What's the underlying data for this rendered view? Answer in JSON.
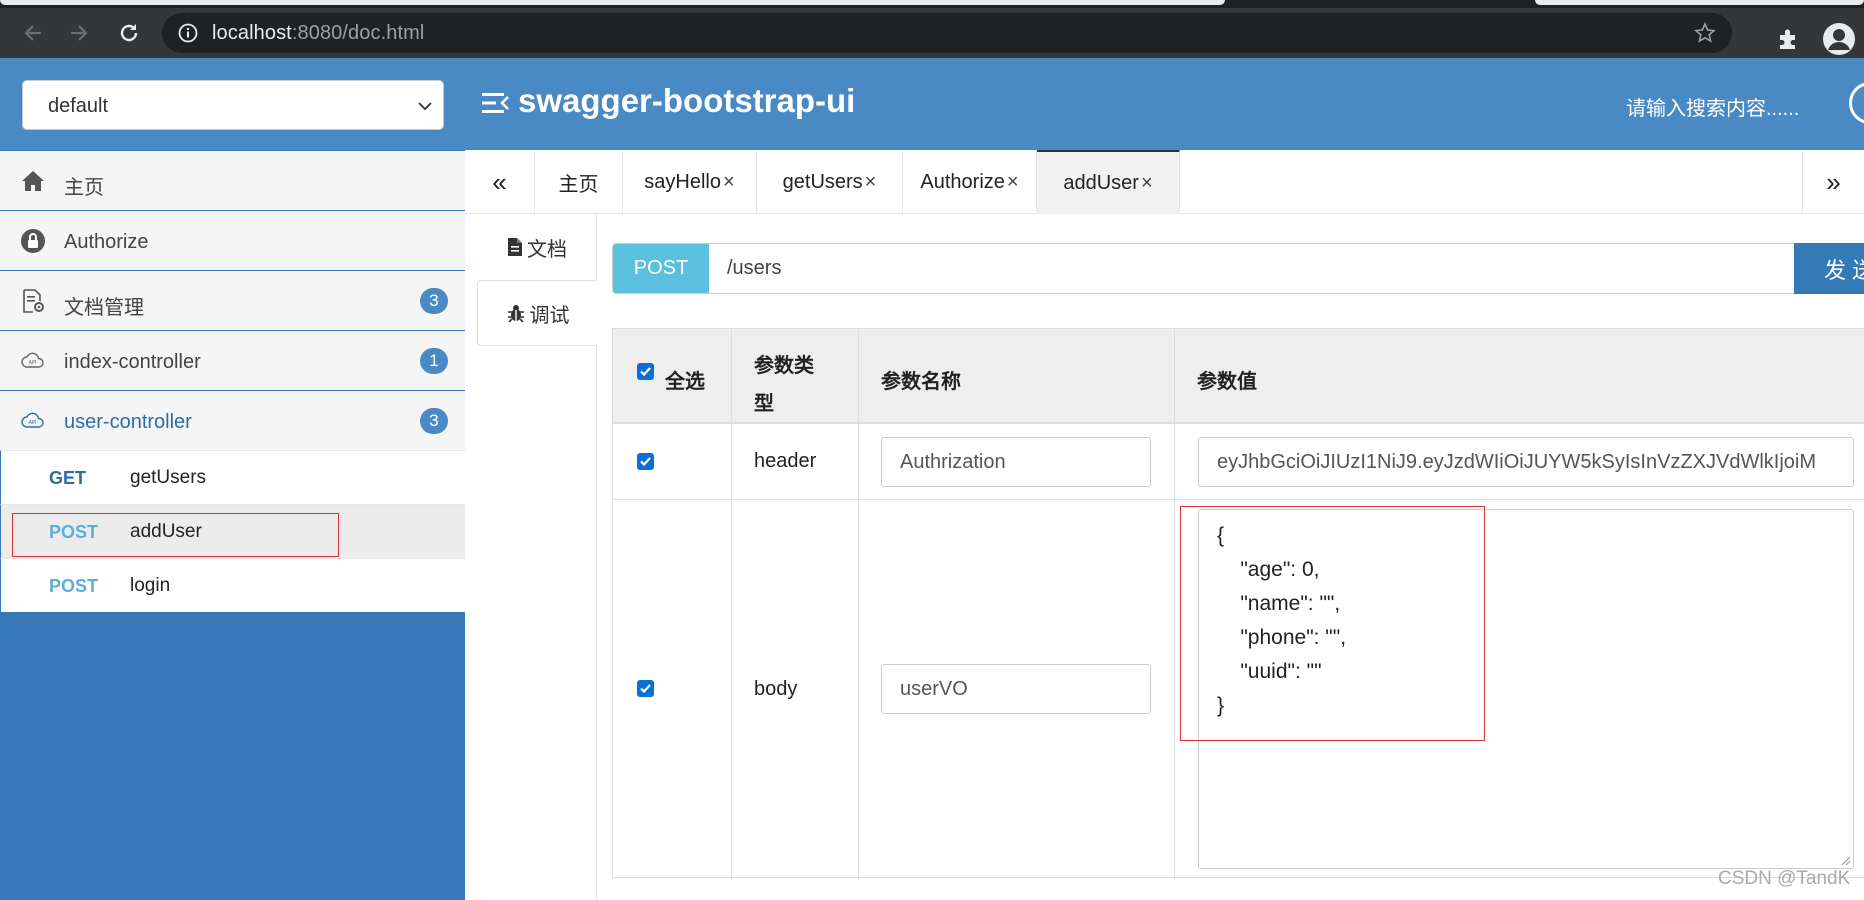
{
  "browser": {
    "url_host": "localhost",
    "url_rest": ":8080/doc.html",
    "icons": [
      "back-icon",
      "forward-icon",
      "reload-icon",
      "info-icon",
      "star-icon",
      "extensions-icon",
      "profile-icon"
    ]
  },
  "header": {
    "group_select": "default",
    "title": "swagger-bootstrap-ui",
    "search_placeholder": "请输入搜索内容......"
  },
  "sidebar": {
    "items": [
      {
        "label": "主页",
        "icon": "home-icon"
      },
      {
        "label": "Authorize",
        "icon": "lock-icon"
      },
      {
        "label": "文档管理",
        "icon": "doc-settings-icon",
        "badge": "3"
      },
      {
        "label": "index-controller",
        "icon": "api-cloud-icon",
        "badge": "1"
      },
      {
        "label": "user-controller",
        "icon": "api-cloud-icon",
        "badge": "3"
      }
    ],
    "endpoints": [
      {
        "method": "GET",
        "name": "getUsers"
      },
      {
        "method": "POST",
        "name": "addUser"
      },
      {
        "method": "POST",
        "name": "login"
      }
    ]
  },
  "tabs": {
    "prev": "«",
    "next": "»",
    "items": [
      {
        "label": "主页",
        "closable": false
      },
      {
        "label": "sayHello",
        "closable": true
      },
      {
        "label": "getUsers",
        "closable": true
      },
      {
        "label": "Authorize",
        "closable": true
      },
      {
        "label": "addUser",
        "closable": true
      }
    ],
    "close_glyph": "×"
  },
  "subtabs": {
    "doc": "文档",
    "debug": "调试"
  },
  "request": {
    "method": "POST",
    "url": "/users",
    "send_label": "发 送"
  },
  "params": {
    "headers": {
      "select_all": "全选",
      "type_line1": "参数类",
      "type_line2": "型",
      "name": "参数名称",
      "value": "参数值"
    },
    "rows": [
      {
        "type": "header",
        "name": "Authrization",
        "value": "eyJhbGciOiJIUzI1NiJ9.eyJzdWIiOiJUYW5kSyIsInVzZXJVdWlkIjoiM"
      },
      {
        "type": "body",
        "name": "userVO",
        "value_lines": [
          "{",
          "    \"age\": 0,",
          "    \"name\": \"\",",
          "    \"phone\": \"\",",
          "    \"uuid\": \"\"",
          "}"
        ]
      }
    ]
  },
  "watermark": "CSDN @TandK",
  "colors": {
    "header_blue": "#4a8ac4",
    "sidebar_blue": "#3779b8",
    "post_badge": "#5bc0de",
    "send_button": "#337ab7",
    "highlight_red": "#e03030"
  }
}
